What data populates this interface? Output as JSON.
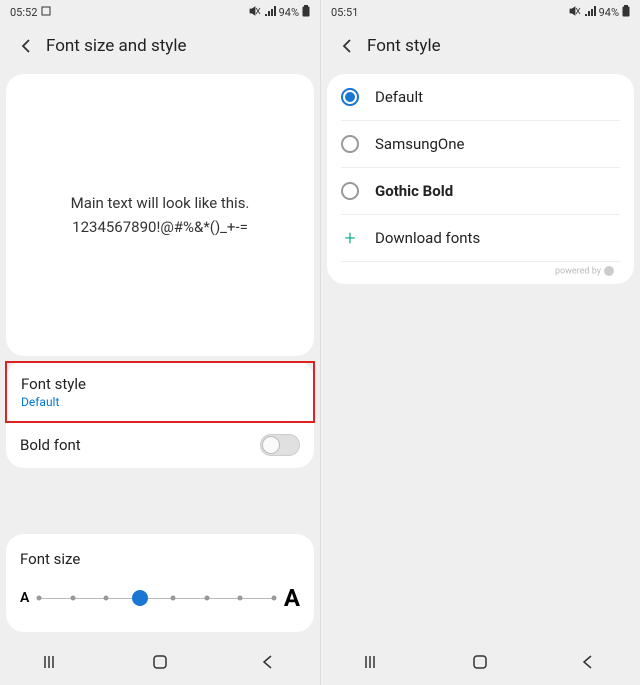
{
  "left": {
    "status": {
      "time": "05:52",
      "battery": "94%"
    },
    "header": {
      "title": "Font size and style"
    },
    "preview": {
      "line1": "Main text will look like this.",
      "line2": "1234567890!@#%&*()_+-="
    },
    "settings": {
      "font_style": {
        "title": "Font style",
        "value": "Default"
      },
      "bold_font": {
        "title": "Bold font",
        "enabled": false
      }
    },
    "font_size": {
      "title": "Font size",
      "steps": 8,
      "current": 3
    }
  },
  "right": {
    "status": {
      "time": "05:51",
      "battery": "94%"
    },
    "header": {
      "title": "Font style"
    },
    "fonts": [
      {
        "name": "Default",
        "selected": true,
        "bold": false
      },
      {
        "name": "SamsungOne",
        "selected": false,
        "bold": false
      },
      {
        "name": "Gothic Bold",
        "selected": false,
        "bold": true
      }
    ],
    "download": {
      "label": "Download fonts"
    },
    "powered": "powered by"
  }
}
